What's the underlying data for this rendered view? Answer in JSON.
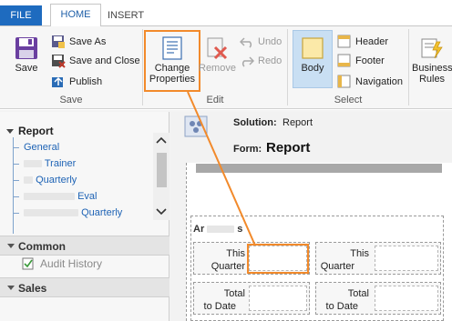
{
  "ribbon": {
    "tabs": {
      "file": "FILE",
      "home": "HOME",
      "insert": "INSERT"
    },
    "save_group": {
      "save": "Save",
      "save_as": "Save As",
      "save_and_close": "Save and Close",
      "publish": "Publish",
      "label": "Save"
    },
    "edit_group": {
      "change_properties_line1": "Change",
      "change_properties_line2": "Properties",
      "remove": "Remove",
      "undo": "Undo",
      "redo": "Redo",
      "label": "Edit"
    },
    "select_group": {
      "body": "Body",
      "header": "Header",
      "footer": "Footer",
      "navigation": "Navigation",
      "label": "Select"
    },
    "business_rules": {
      "line1": "Business",
      "line2": "Rules"
    }
  },
  "nav": {
    "title": "Report",
    "links": [
      "General",
      "Trainer",
      "Quarterly",
      "Eval",
      "Quarterly"
    ],
    "sections": {
      "common": "Common",
      "audit_history": "Audit History",
      "sales": "Sales"
    }
  },
  "form": {
    "solution_label": "Solution:",
    "solution_value": "Report",
    "form_label": "Form:",
    "form_value": "Report",
    "section_title_start": "Ar",
    "section_title_end": "s",
    "fields": {
      "this_quarter_1": {
        "line1": "This",
        "line2": "Quarter"
      },
      "this_quarter_2": {
        "line1": "This",
        "line2": "Quarter"
      },
      "total_to_date_1": {
        "line1": "Total",
        "line2": "to Date"
      },
      "total_to_date_2": {
        "line1": "Total",
        "line2": "to Date"
      }
    }
  },
  "colors": {
    "accent_blue": "#1e6bbf",
    "highlight_orange": "#f28a2b",
    "body_selected": "#c9dff3",
    "link_blue": "#1e63b5"
  }
}
